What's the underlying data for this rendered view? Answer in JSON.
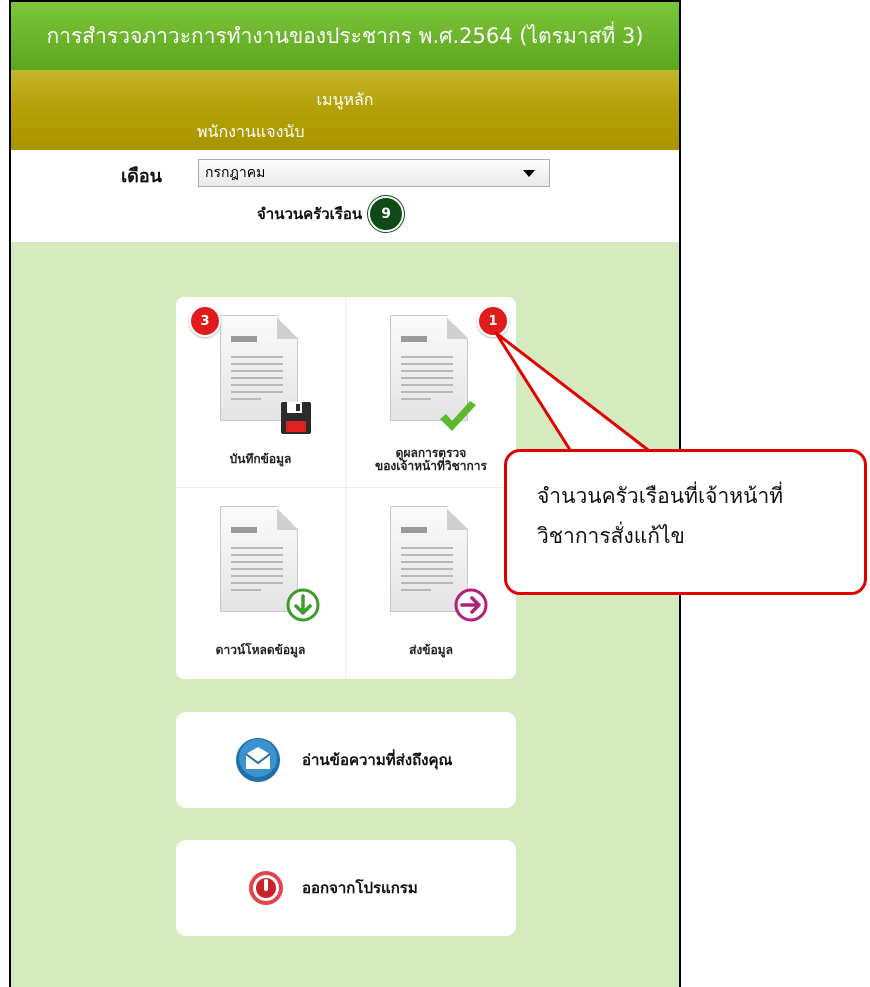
{
  "header": {
    "title": "การสำรวจภาวะการทำงานของประชากร พ.ศ.2564 (ไตรมาสที่ 3)",
    "menu_title": "เมนูหลัก",
    "role": "พนักงานแจงนับ"
  },
  "filter": {
    "month_label": "เดือน",
    "month_value": "กรกฎาคม",
    "household_label": "จำนวนครัวเรือน",
    "household_count": "9"
  },
  "tiles": [
    {
      "label": "บันทึกข้อมูล",
      "badge": "3",
      "overlay_icon": "floppy-disk-icon"
    },
    {
      "label_line1": "ดูผลการตรวจ",
      "label_line2": "ของเจ้าหน้าที่วิชาการ",
      "badge": "1",
      "overlay_icon": "check-icon"
    },
    {
      "label": "ดาวน์โหลดข้อมูล",
      "overlay_icon": "download-arrow-icon"
    },
    {
      "label": "ส่งข้อมูล",
      "overlay_icon": "send-arrow-icon"
    }
  ],
  "buttons": {
    "messages": "อ่านข้อความที่ส่งถึงคุณ",
    "exit": "ออกจากโปรแกรม"
  },
  "callout": {
    "line1": "จำนวนครัวเรือนที่เจ้าหน้าที่",
    "line2": "วิชาการสั่งแก้ไข"
  },
  "colors": {
    "title_bar": "#6ab42a",
    "menu_bar": "#b4a20a",
    "content_bg": "#d6eabf",
    "badge_red": "#e01b1b",
    "household_badge": "#0e4b17",
    "callout_border": "#e00000"
  }
}
